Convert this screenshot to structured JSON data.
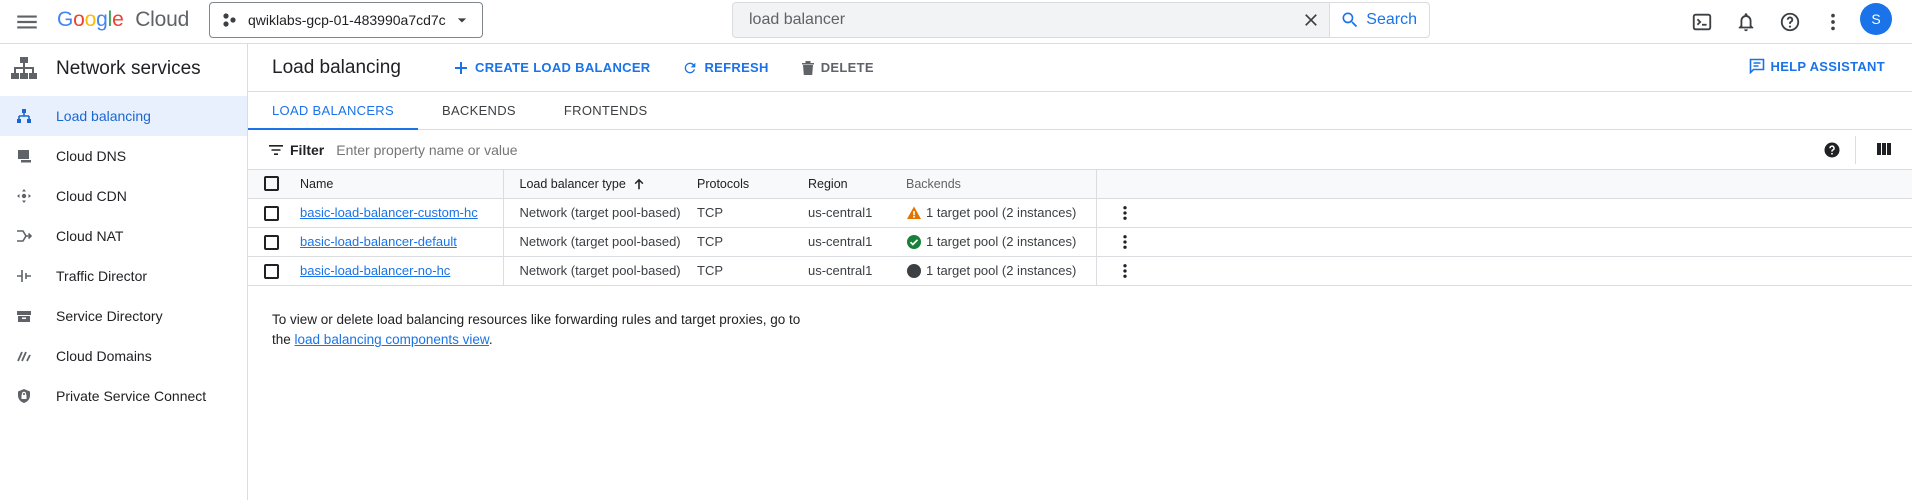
{
  "colors": {
    "accent": "#1a73e8",
    "warning": "#e37400",
    "success": "#188038",
    "neutral": "#3c4043",
    "active_bg": "#e8f0fe"
  },
  "topbar": {
    "menu_icon": "hamburger-menu-icon",
    "logo": {
      "google": [
        "G",
        "o",
        "o",
        "g",
        "l",
        "e"
      ],
      "cloud": "Cloud"
    },
    "project": {
      "label": "qwiklabs-gcp-01-483990a7cd7c"
    },
    "search": {
      "value": "load balancer",
      "button_label": "Search"
    },
    "icons": [
      "cloud-shell-icon",
      "notifications-icon",
      "help-icon",
      "more-vert-icon"
    ],
    "avatar": "S"
  },
  "sidebar": {
    "title": "Network services",
    "items": [
      {
        "label": "Load balancing",
        "icon": "load-balancing-icon",
        "active": true
      },
      {
        "label": "Cloud DNS",
        "icon": "cloud-dns-icon"
      },
      {
        "label": "Cloud CDN",
        "icon": "cloud-cdn-icon"
      },
      {
        "label": "Cloud NAT",
        "icon": "cloud-nat-icon"
      },
      {
        "label": "Traffic Director",
        "icon": "traffic-director-icon"
      },
      {
        "label": "Service Directory",
        "icon": "service-directory-icon"
      },
      {
        "label": "Cloud Domains",
        "icon": "cloud-domains-icon"
      },
      {
        "label": "Private Service Connect",
        "icon": "private-service-connect-icon"
      }
    ]
  },
  "header": {
    "title": "Load balancing",
    "create_label": "CREATE LOAD BALANCER",
    "refresh_label": "REFRESH",
    "delete_label": "DELETE",
    "help_assistant_label": "HELP ASSISTANT"
  },
  "tabs": [
    {
      "label": "LOAD BALANCERS",
      "active": true
    },
    {
      "label": "BACKENDS"
    },
    {
      "label": "FRONTENDS"
    }
  ],
  "filter": {
    "label": "Filter",
    "placeholder": "Enter property name or value"
  },
  "table": {
    "columns": {
      "name": "Name",
      "type": "Load balancer type",
      "protocols": "Protocols",
      "region": "Region",
      "backends": "Backends"
    },
    "rows": [
      {
        "name": "basic-load-balancer-custom-hc",
        "type": "Network (target pool-based)",
        "protocols": "TCP",
        "region": "us-central1",
        "backends": "1 target pool (2 instances)",
        "status": "warning"
      },
      {
        "name": "basic-load-balancer-default",
        "type": "Network (target pool-based)",
        "protocols": "TCP",
        "region": "us-central1",
        "backends": "1 target pool (2 instances)",
        "status": "ok"
      },
      {
        "name": "basic-load-balancer-no-hc",
        "type": "Network (target pool-based)",
        "protocols": "TCP",
        "region": "us-central1",
        "backends": "1 target pool (2 instances)",
        "status": "unknown"
      }
    ]
  },
  "note": {
    "text_before": "To view or delete load balancing resources like forwarding rules and target proxies, go to the ",
    "link": "load balancing components view",
    "text_after": "."
  }
}
